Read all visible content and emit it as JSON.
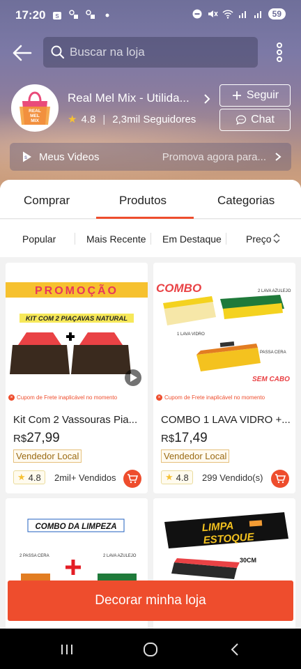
{
  "status": {
    "time": "17:20",
    "battery": "59"
  },
  "search": {
    "placeholder": "Buscar na loja"
  },
  "store": {
    "name": "Real Mel Mix - Utilida...",
    "rating": "4.8",
    "followers": "2,3mil Seguidores",
    "logo_text": "REAL MEL MIX",
    "follow_label": "Seguir",
    "chat_label": "Chat"
  },
  "videos": {
    "label": "Meus Videos",
    "promo": "Promova agora para..."
  },
  "tabs": [
    "Comprar",
    "Produtos",
    "Categorias"
  ],
  "sorts": [
    "Popular",
    "Mais Recente",
    "Em Destaque",
    "Preço"
  ],
  "products": [
    {
      "banner": "PROMOÇÃO",
      "subtitle": "KIT COM 2 PIAÇAVAS NATURAL",
      "coupon": "Cupom de Frete inaplicável no momento",
      "name": "Kit Com 2 Vassouras Pia...",
      "currency": "R$",
      "price": "27,99",
      "badge": "Vendedor Local",
      "rating": "4.8",
      "sold": "2mil+ Vendidos"
    },
    {
      "banner": "COMBO",
      "label_a": "2 LAVA AZULEJO",
      "label_b": "1 LAVA VIDRO",
      "label_c": "1 PASSA CERA",
      "label_d": "SEM CABO",
      "coupon": "Cupom de Frete inaplicável no momento",
      "name": "COMBO 1 LAVA VIDRO +...",
      "currency": "R$",
      "price": "17,49",
      "badge": "Vendedor Local",
      "rating": "4.8",
      "sold": "299 Vendido(s)"
    },
    {
      "banner": "COMBO DA LIMPEZA",
      "label_a": "2 PASSA CERA",
      "label_b": "2 LAVA AZULEJO"
    },
    {
      "banner_a": "LIMPA",
      "banner_b": "ESTOQUE",
      "size": "30CM"
    }
  ],
  "decorate_label": "Decorar minha loja",
  "colors": {
    "accent": "#ee4d2d",
    "star": "#f6c133"
  }
}
